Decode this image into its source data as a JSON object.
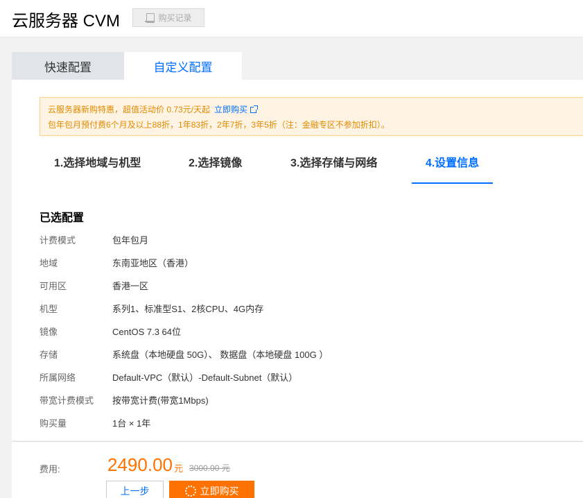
{
  "header": {
    "title": "云服务器 CVM",
    "record_button": "购买记录"
  },
  "tabs": [
    {
      "label": "快速配置",
      "active": false
    },
    {
      "label": "自定义配置",
      "active": true
    }
  ],
  "notice": {
    "line1": "云服务器新购特惠，超值活动价 0.73元/天起",
    "link": "立即购买",
    "line2": "包年包月预付费6个月及以上88折，1年83折，2年7折，3年5折（注：金融专区不参加折扣）。"
  },
  "steps": [
    {
      "label": "1.选择地域与机型"
    },
    {
      "label": "2.选择镜像"
    },
    {
      "label": "3.选择存储与网络"
    },
    {
      "label": "4.设置信息",
      "active": true
    }
  ],
  "summary": {
    "title": "已选配置",
    "rows": [
      {
        "key": "计费模式",
        "value": "包年包月"
      },
      {
        "key": "地域",
        "value": "东南亚地区（香港）"
      },
      {
        "key": "可用区",
        "value": "香港一区"
      },
      {
        "key": "机型",
        "value": "系列1、标准型S1、2核CPU、4G内存"
      },
      {
        "key": "镜像",
        "value": "CentOS 7.3 64位"
      },
      {
        "key": "存储",
        "value": "系统盘（本地硬盘 50G）、 数据盘（本地硬盘 100G ）"
      },
      {
        "key": "所属网络",
        "value": "Default-VPC（默认）-Default-Subnet（默认）"
      },
      {
        "key": "带宽计费模式",
        "value": "按带宽计费(带宽1Mbps)"
      },
      {
        "key": "购买量",
        "value": "1台 × 1年"
      }
    ]
  },
  "footer": {
    "fee_label": "费用:",
    "price": "2490.00",
    "price_unit": "元",
    "original_price": "3000.00 元",
    "prev_button": "上一步",
    "buy_button": "立即购买"
  },
  "colors": {
    "accent": "#006eff",
    "price": "#ff7200",
    "notice_bg": "#fff4e3"
  }
}
